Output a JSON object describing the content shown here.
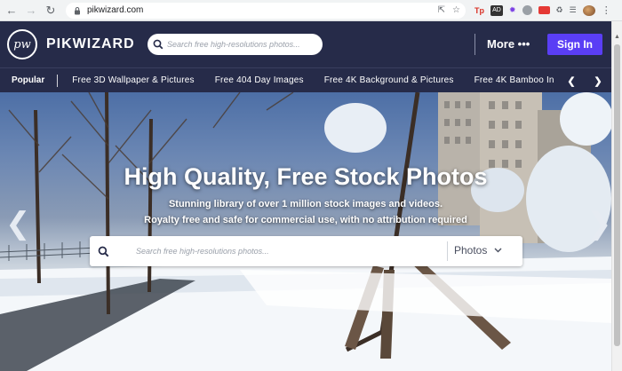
{
  "browser": {
    "url": "pikwizard.com",
    "extensions": [
      "Tp",
      "ad",
      "spark",
      "shield",
      "yt",
      "puzzle",
      "menu-list"
    ]
  },
  "header": {
    "logo_mark": "pw",
    "logo_text": "PIKWIZARD",
    "search_placeholder": "Search free high-resolutions photos...",
    "more_label": "More •••",
    "signin_label": "Sign In",
    "colors": {
      "bg": "#262b49",
      "signin": "#5a3ef5"
    }
  },
  "categories": {
    "popular_label": "Popular",
    "items": [
      "Free 3D Wallpaper & Pictures",
      "Free 404 Day Images",
      "Free 4K Background & Pictures",
      "Free 4K Bamboo In"
    ],
    "prev_icon": "chevron-left",
    "next_icon": "chevron-right"
  },
  "hero": {
    "title": "High Quality, Free Stock Photos",
    "subtitle_1": "Stunning library of over 1 million stock images and videos.",
    "subtitle_2": "Royalty free and safe for commercial use, with no attribution required",
    "search_placeholder": "Search free high-resolutions photos...",
    "type_selected": "Photos"
  }
}
